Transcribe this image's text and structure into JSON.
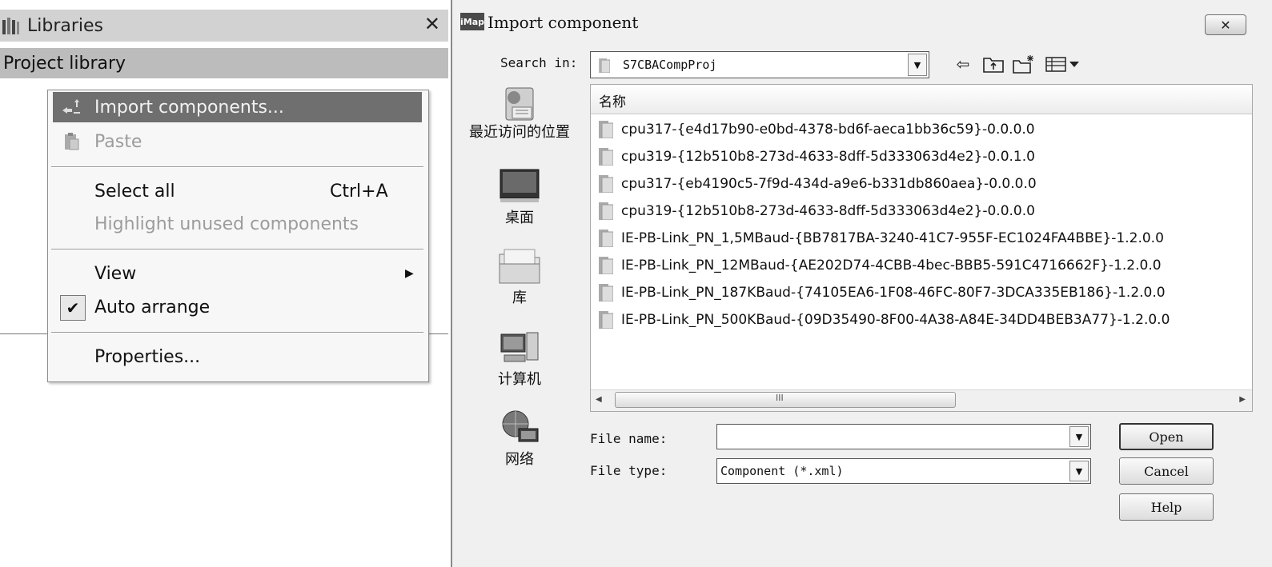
{
  "libraries_panel": {
    "title": "Libraries",
    "close_glyph": "✕",
    "subtitle": "Project library"
  },
  "context_menu": {
    "items": [
      {
        "label": "Import components...",
        "icon": "import-icon",
        "state": "highlighted"
      },
      {
        "label": "Paste",
        "icon": "paste-icon",
        "state": "disabled"
      },
      {
        "label": "Select all",
        "shortcut": "Ctrl+A",
        "state": "enabled"
      },
      {
        "label": "Highlight unused components",
        "state": "disabled"
      },
      {
        "label": "View",
        "submenu": true,
        "state": "enabled"
      },
      {
        "label": "Auto arrange",
        "checked": true,
        "state": "enabled"
      },
      {
        "label": "Properties...",
        "state": "enabled"
      }
    ]
  },
  "dialog": {
    "logo_text": "iMap",
    "title": "Import component",
    "close_glyph": "✕",
    "search_label": "Search in:",
    "search_value": "S7CBACompProj",
    "toolbar_icons": [
      "back-icon",
      "up-folder-icon",
      "new-folder-icon",
      "view-menu-icon"
    ],
    "places": [
      {
        "label": "最近访问的位置",
        "icon": "recent-places-icon"
      },
      {
        "label": "桌面",
        "icon": "desktop-icon"
      },
      {
        "label": "库",
        "icon": "libraries-icon"
      },
      {
        "label": "计算机",
        "icon": "computer-icon"
      },
      {
        "label": "网络",
        "icon": "network-icon"
      }
    ],
    "column_header": "名称",
    "files": [
      "cpu317-{e4d17b90-e0bd-4378-bd6f-aeca1bb36c59}-0.0.0.0",
      "cpu319-{12b510b8-273d-4633-8dff-5d333063d4e2}-0.0.1.0",
      "cpu317-{eb4190c5-7f9d-434d-a9e6-b331db860aea}-0.0.0.0",
      "cpu319-{12b510b8-273d-4633-8dff-5d333063d4e2}-0.0.0.0",
      "IE-PB-Link_PN_1,5MBaud-{BB7817BA-3240-41C7-955F-EC1024FA4BBE}-1.2.0.0",
      "IE-PB-Link_PN_12MBaud-{AE202D74-4CBB-4bec-BBB5-591C4716662F}-1.2.0.0",
      "IE-PB-Link_PN_187KBaud-{74105EA6-1F08-46FC-80F7-3DCA335EB186}-1.2.0.0",
      "IE-PB-Link_PN_500KBaud-{09D35490-8F00-4A38-A84E-34DD4BEB3A77}-1.2.0.0"
    ],
    "scroll_grip": "III",
    "file_name_label": "File name:",
    "file_name_value": "",
    "file_type_label": "File type:",
    "file_type_value": "Component (*.xml)",
    "buttons": {
      "open": "Open",
      "cancel": "Cancel",
      "help": "Help"
    }
  }
}
